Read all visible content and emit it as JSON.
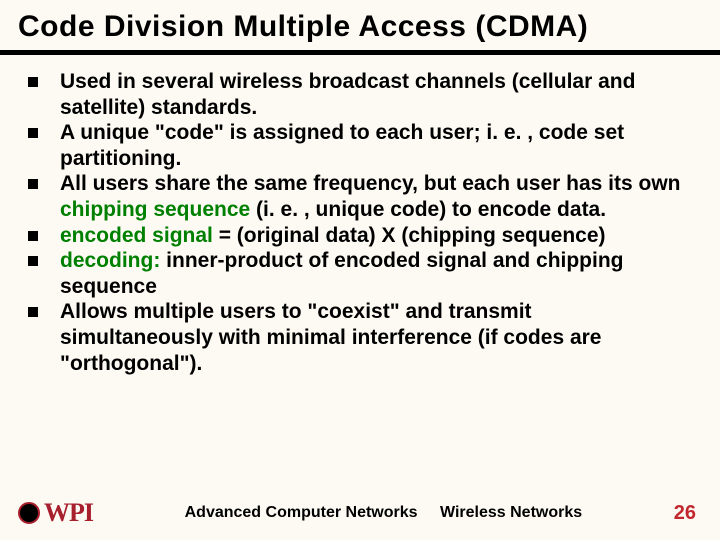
{
  "title": "Code Division Multiple Access (CDMA)",
  "bullets": [
    {
      "pre": "Used  in several wireless broadcast channels (cellular and satellite) standards.",
      "green": "",
      "post": ""
    },
    {
      "pre": "A unique \"code\" is assigned to each user; i. e. , code set partitioning.",
      "green": "",
      "post": ""
    },
    {
      "pre": "All users share the same frequency, but each user has its own ",
      "green": "chipping sequence",
      "post": " (i. e. , unique code) to encode data."
    },
    {
      "pre": "",
      "green": "encoded signal",
      "post": " = (original data) X (chipping sequence)"
    },
    {
      "pre": "",
      "green": "decoding:",
      "post": " inner-product of encoded signal and chipping sequence"
    },
    {
      "pre": "Allows multiple users to \"coexist\" and transmit simultaneously with minimal interference (if codes are \"orthogonal\").",
      "green": "",
      "post": ""
    }
  ],
  "footer": {
    "course": "Advanced Computer Networks",
    "topic": "Wireless Networks",
    "page": "26",
    "logo_text": "WPI"
  }
}
